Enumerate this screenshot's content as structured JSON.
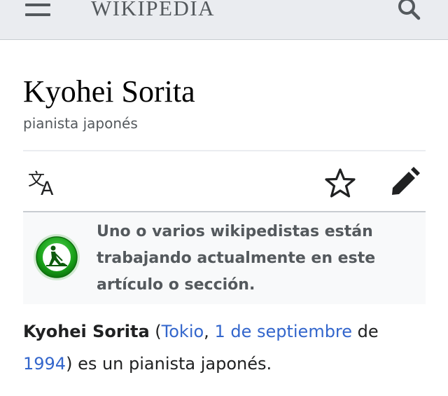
{
  "header": {
    "logo_text": "WIKIPEDIA",
    "menu_icon": "hamburger-menu-icon",
    "search_icon": "search-icon",
    "background": "#eaecf0"
  },
  "page": {
    "title": "Kyohei Sorita",
    "description": "pianista japonés"
  },
  "actions": {
    "language_icon": "language-icon",
    "watch_icon": "star-icon",
    "edit_icon": "pencil-icon"
  },
  "notice": {
    "icon": "under-construction-icon",
    "text": "Uno o varios wikipedistas están trabajando actualmente en este artículo o sección."
  },
  "lead": {
    "subject": "Kyohei Sorita",
    "open_paren": " (",
    "birthplace": "Tokio",
    "comma": ", ",
    "birth_date": "1 de septiembre",
    "de": " de ",
    "birth_year": "1994",
    "close_rest": ") es un pianista japonés."
  },
  "colors": {
    "link": "#3366cc",
    "text": "#202122",
    "muted": "#54595d",
    "notice_icon_green": "#1aa31a"
  }
}
